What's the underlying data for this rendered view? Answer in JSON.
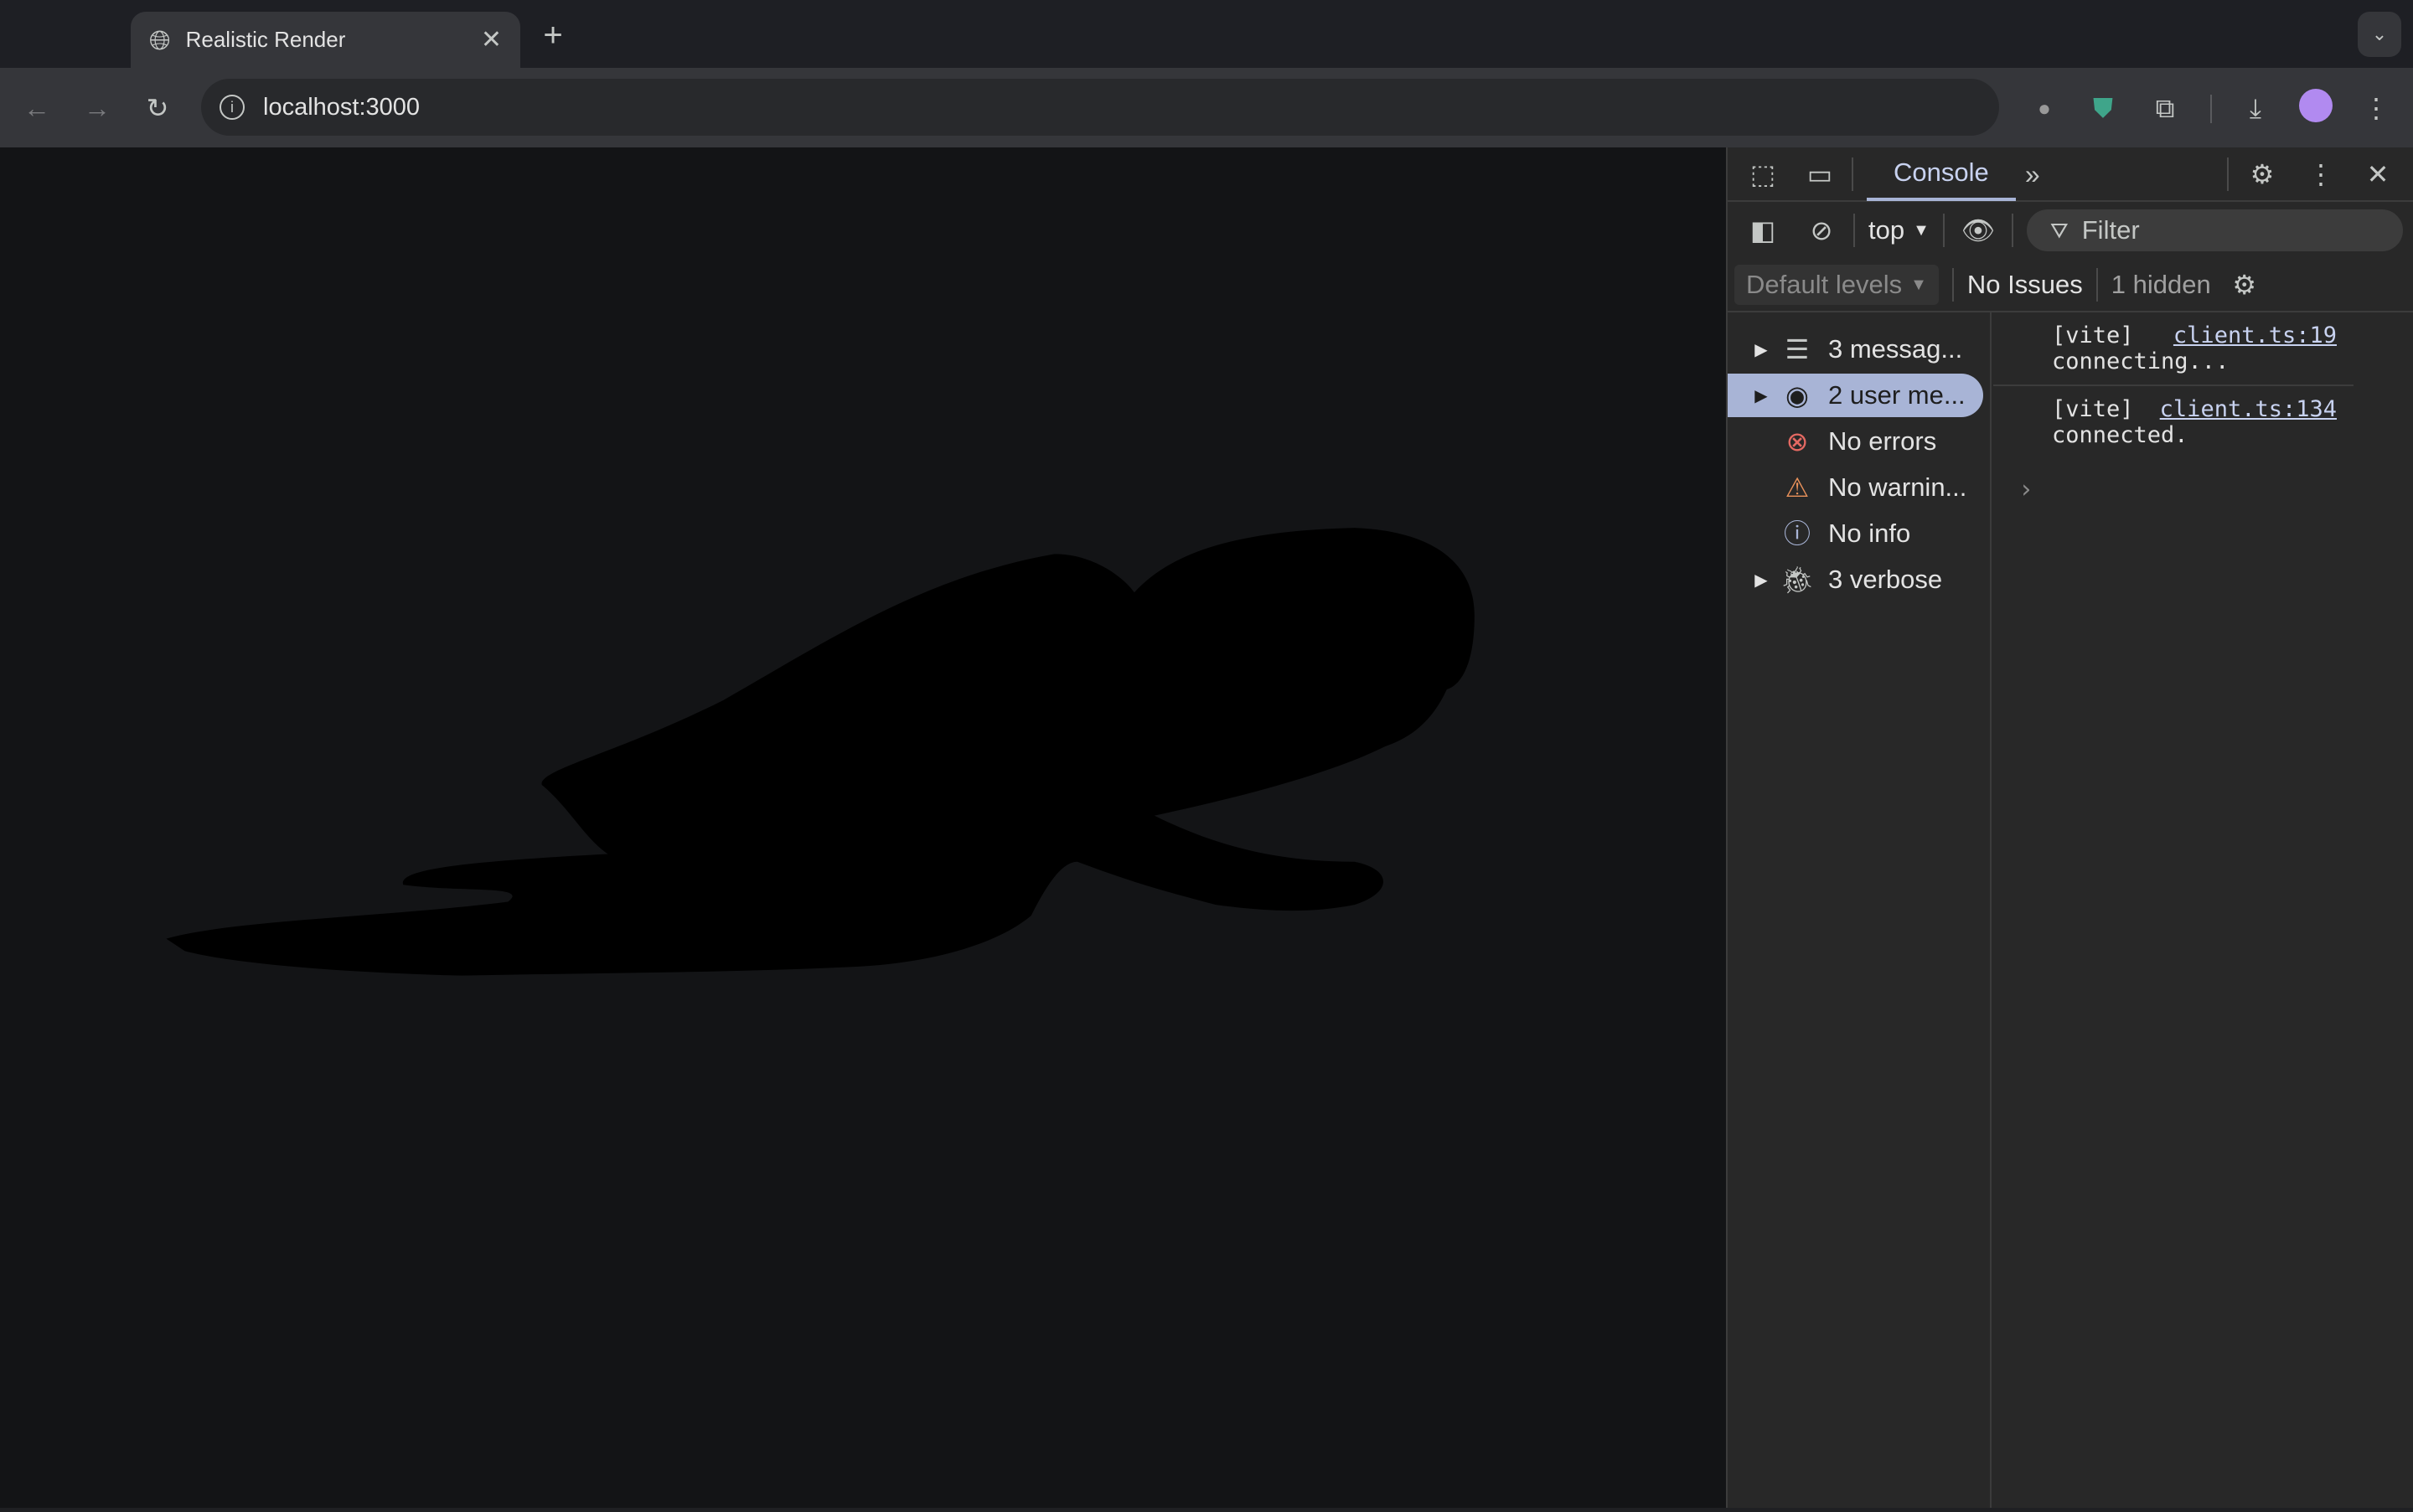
{
  "browser": {
    "tab_title": "Realistic Render",
    "url": "localhost:3000"
  },
  "devtools": {
    "active_tab": "Console",
    "context": "top",
    "filter_placeholder": "Filter",
    "levels": "Default levels",
    "issues": "No Issues",
    "hidden": "1 hidden",
    "sidebar": [
      {
        "label": "3 messag...",
        "icon": "list-icon",
        "expandable": true
      },
      {
        "label": "2 user me...",
        "icon": "user-icon",
        "expandable": true,
        "selected": true
      },
      {
        "label": "No errors",
        "icon": "error-icon",
        "color": "#e46962"
      },
      {
        "label": "No warnin...",
        "icon": "warning-icon",
        "color": "#e9915a"
      },
      {
        "label": "No info",
        "icon": "info-icon",
        "color": "#a8b4d6"
      },
      {
        "label": "3 verbose",
        "icon": "bug-icon",
        "expandable": true
      }
    ],
    "messages": [
      {
        "source": "[vite]",
        "link": "client.ts:19",
        "text": "connecting..."
      },
      {
        "source": "[vite]",
        "link": "client.ts:134",
        "text": "connected."
      }
    ]
  },
  "colors": {
    "page_bg": "#131416",
    "silhouette": "#000000",
    "accent": "#a8b4d6"
  }
}
